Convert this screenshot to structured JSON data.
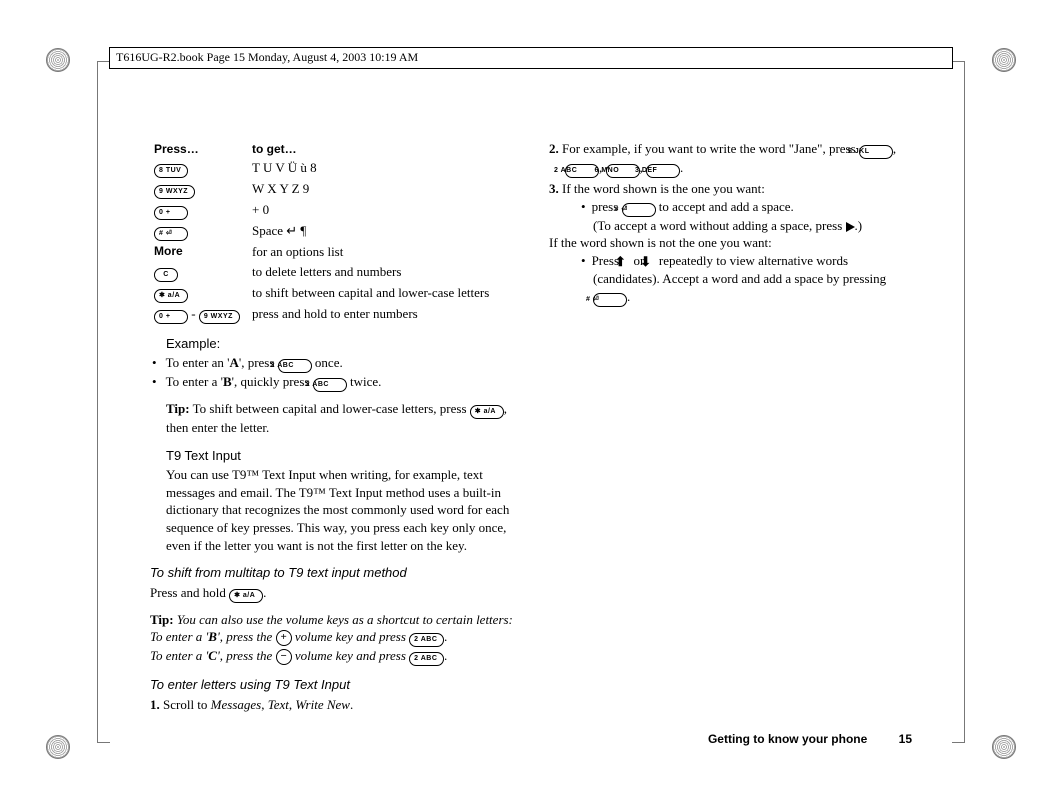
{
  "topbar": "T616UG-R2.book  Page 15  Monday, August 4, 2003  10:19 AM",
  "table": {
    "head_press": "Press…",
    "head_get": "to get…",
    "rows": [
      {
        "key": "8 TUV",
        "get": "T U V Ü ù 8"
      },
      {
        "key": "9 WXYZ",
        "get": "W X Y Z 9"
      },
      {
        "key": "0 +",
        "get": "+ 0"
      },
      {
        "key": "# ⏎",
        "get": "Space ↵ ¶"
      },
      {
        "key_text": "More",
        "get": "for an options list"
      },
      {
        "key": "C",
        "get": "to delete letters and numbers"
      },
      {
        "key": "✱ a/A",
        "get": "to shift between capital and lower-case letters"
      },
      {
        "key_combo_a": "0 +",
        "key_combo_sep": "-",
        "key_combo_b": "9 WXYZ",
        "get": "press and hold to enter numbers"
      }
    ]
  },
  "example_heading": "Example:",
  "example_items": {
    "a1": "To enter an '",
    "a_bold": "A",
    "a2": "', press ",
    "a_key": "2 ABC",
    "a3": " once.",
    "b1": "To enter a '",
    "b_bold": "B",
    "b2": "', quickly press ",
    "b_key": "2 ABC",
    "b3": " twice."
  },
  "tip1": {
    "label": "Tip:",
    "part1": " To shift between capital and lower-case letters, press ",
    "key": "✱ a/A",
    "part2": ", then enter the letter."
  },
  "t9_heading": "T9 Text Input",
  "t9_para": "You can use T9™ Text Input when writing, for example, text messages and email. The T9™ Text Input method uses a built-in dictionary that recognizes the most commonly used word for each sequence of key presses. This way, you press each key only once, even if the letter you want is not the first letter on the key.",
  "shift_heading": "To shift from multitap to T9 text input method",
  "shift_para_1": "Press and hold ",
  "shift_key": "✱ a/A",
  "shift_para_2": ".",
  "tip2": {
    "label": "Tip:",
    "line1": " You can also use the volume keys as a shortcut to certain letters:",
    "b_pre": "To enter a '",
    "b_bold": "B",
    "b_mid": "', press the ",
    "b_vol": "+",
    "b_post": " volume key and press ",
    "b_key": "2 ABC",
    "b_end": ".",
    "c_pre": "To enter a '",
    "c_bold": "C",
    "c_mid": "', press the ",
    "c_vol": "−",
    "c_post": " volume key and press ",
    "c_key": "2 ABC",
    "c_end": "."
  },
  "enter_heading": "To enter letters using T9 Text Input",
  "steps": {
    "s1_a": "Scroll to ",
    "s1_b": "Messages",
    "s1_c": ", ",
    "s1_d": "Text",
    "s1_e": ", ",
    "s1_f": "Write New",
    "s1_g": ".",
    "s2_a": "For example, if you want to write the word \"Jane\", press ",
    "s2_k1": "5 JKL",
    "s2_k2": "2 ABC",
    "s2_k3": "6 MNO",
    "s2_k4": "3 DEF",
    "s2_end": ".",
    "s3_a": "If the word shown is the one you want:",
    "s3_b1_a": "press ",
    "s3_b1_key": "# ⏎",
    "s3_b1_b": " to accept and add a space.",
    "s3_paren_a": "(To accept a word without adding a space, press ",
    "s3_paren_b": ".)",
    "s3_c": "If the word shown is not the one you want:",
    "s3_d_a": "Press ",
    "s3_d_up": "↑",
    "s3_d_or": " or ",
    "s3_d_down": "↓",
    "s3_d_b": " repeatedly to view alternative words (candidates). Accept a word and add a space by pressing ",
    "s3_d_key": "# ⏎",
    "s3_d_end": "."
  },
  "footer": {
    "section": "Getting to know your phone",
    "page": "15"
  }
}
